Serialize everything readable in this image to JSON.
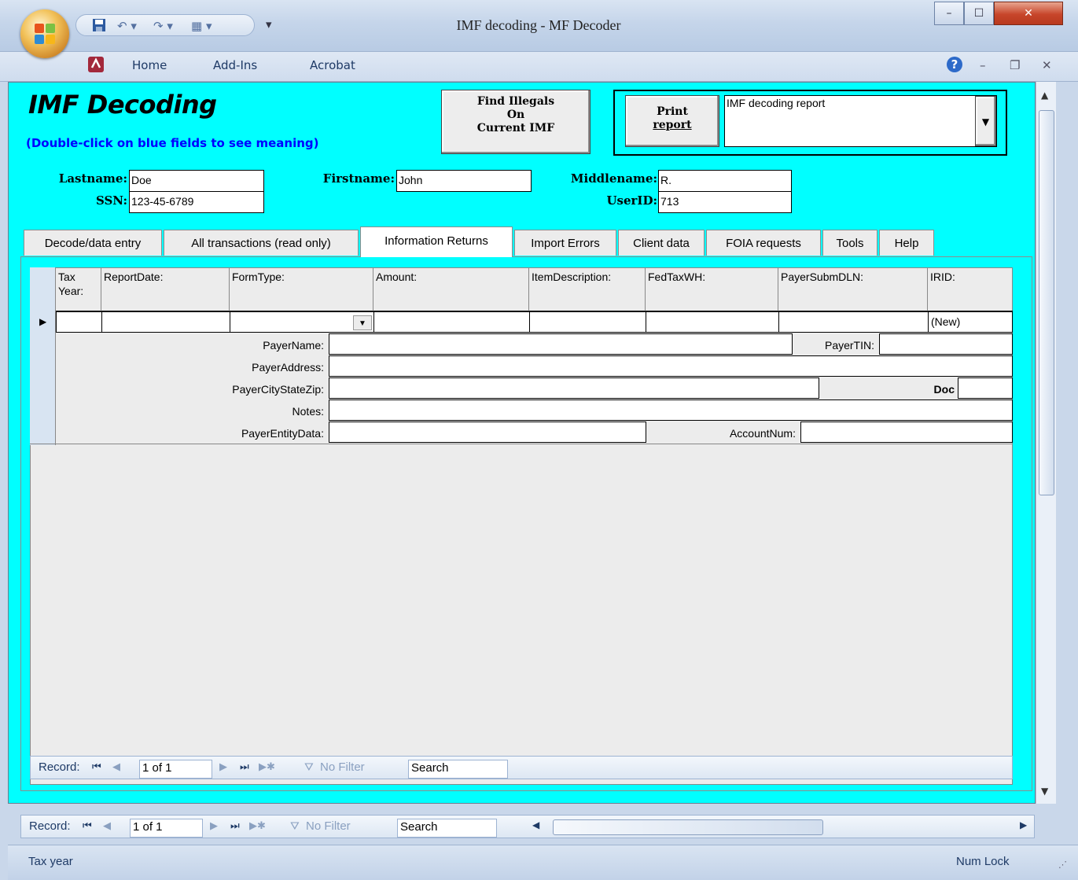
{
  "window": {
    "title": "IMF decoding - MF Decoder",
    "min": "–",
    "max": "☐",
    "close": "✕"
  },
  "ribbon": {
    "tabs": [
      "Home",
      "Add-Ins",
      "Acrobat"
    ],
    "help": "?",
    "min": "–",
    "restore": "❐",
    "close": "✕"
  },
  "form": {
    "title": "IMF Decoding",
    "subtitle": "(Double-click on blue fields to see meaning)",
    "find_button": [
      "Find Illegals",
      "On",
      "Current IMF"
    ],
    "print_button": [
      "Print",
      "report"
    ],
    "report_select": "IMF decoding report"
  },
  "person": {
    "lastname_label": "Lastname:",
    "lastname": "Doe",
    "firstname_label": "Firstname:",
    "firstname": "John",
    "middlename_label": "Middlename:",
    "middlename": "R.",
    "ssn_label": "SSN:",
    "ssn": "123-45-6789",
    "userid_label": "UserID:",
    "userid": "713"
  },
  "tabs": [
    "Decode/data entry",
    "All transactions (read only)",
    "Information Returns",
    "Import Errors",
    "Client data",
    "FOIA requests",
    "Tools",
    "Help"
  ],
  "active_tab": "Information Returns",
  "grid": {
    "headers": [
      "Tax\nYear:",
      "ReportDate:",
      "FormType:",
      "Amount:",
      "ItemDescription:",
      "FedTaxWH:",
      "PayerSubmDLN:",
      "IRID:"
    ],
    "new_row_irid": "(New)"
  },
  "payer": {
    "name_label": "PayerName:",
    "tin_label": "PayerTIN:",
    "address_label": "PayerAddress:",
    "citystatezip_label": "PayerCityStateZip:",
    "doc_label": "Doc",
    "notes_label": "Notes:",
    "entity_label": "PayerEntityData:",
    "account_label": "AccountNum:"
  },
  "subnav": {
    "record_label": "Record:",
    "position": "1 of 1",
    "filter": "No Filter",
    "search": "Search"
  },
  "mainnav": {
    "record_label": "Record:",
    "position": "1 of 1",
    "filter": "No Filter",
    "search": "Search"
  },
  "status": {
    "left": "Tax year",
    "right": "Num Lock"
  }
}
